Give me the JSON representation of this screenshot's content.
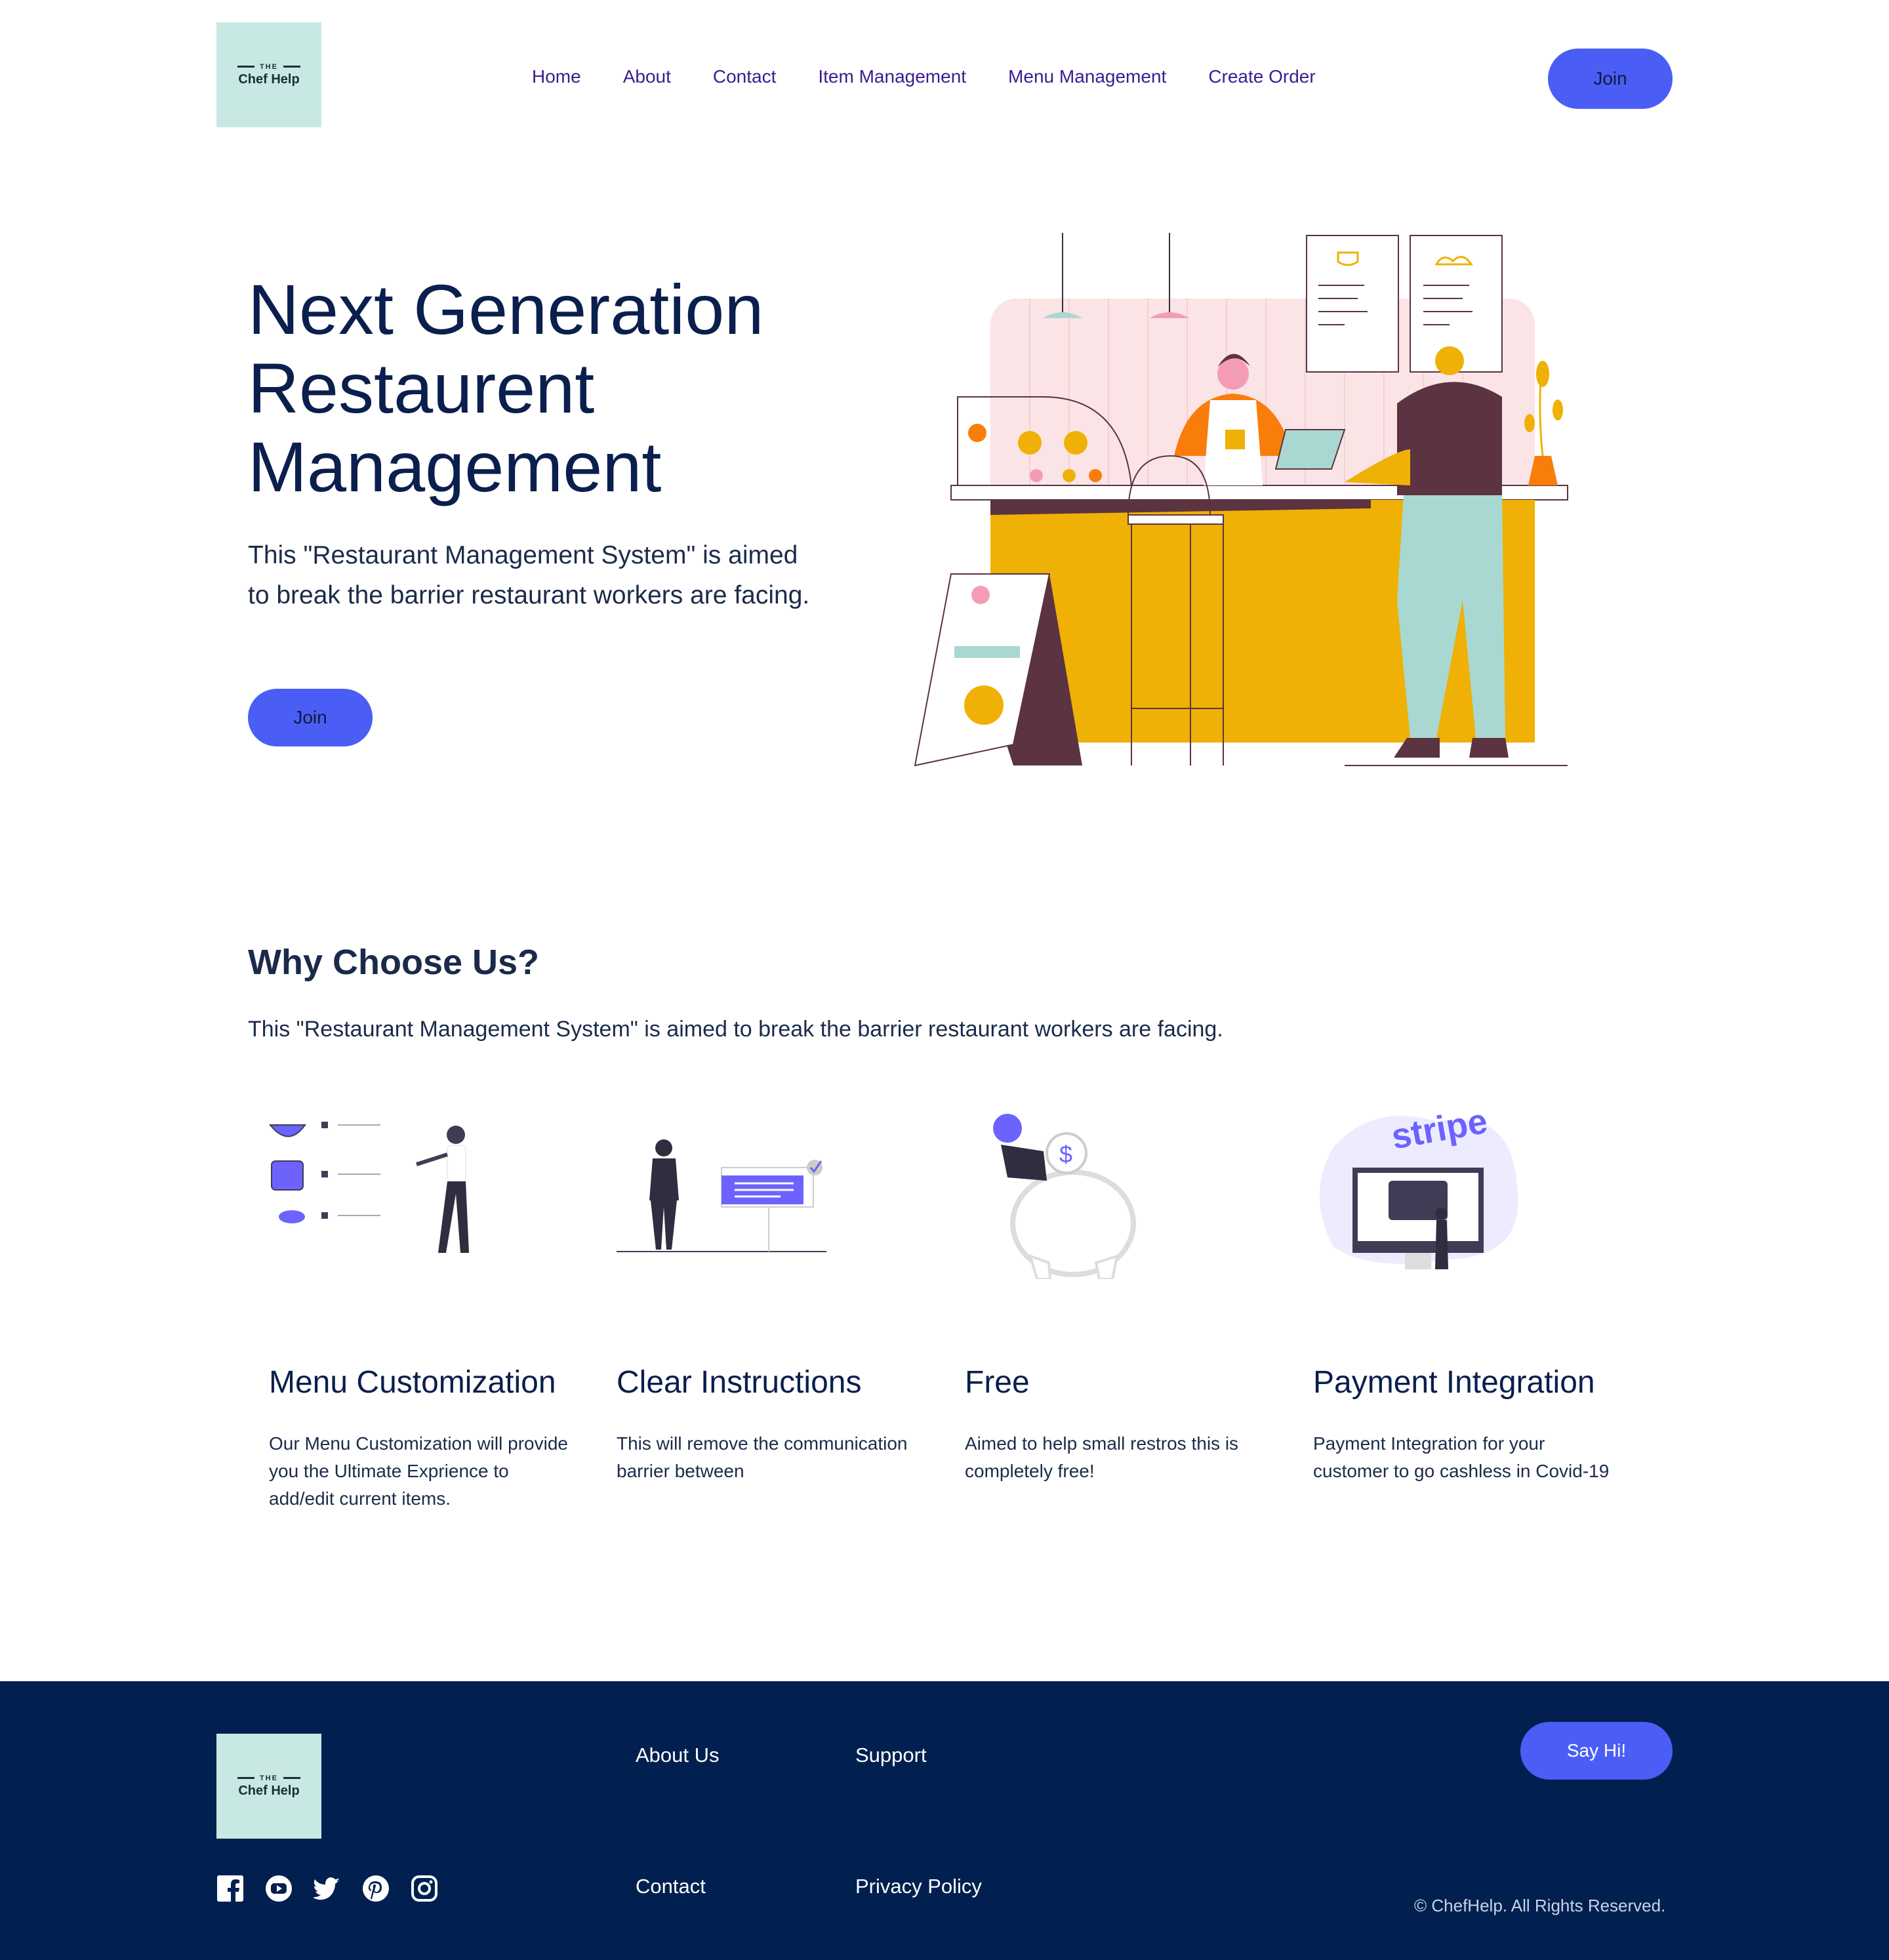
{
  "brand": {
    "logo_small": "THE",
    "logo_name": "Chef Help"
  },
  "nav": {
    "items": [
      "Home",
      "About",
      "Contact",
      "Item Management",
      "Menu Management",
      "Create Order"
    ],
    "join_label": "Join"
  },
  "hero": {
    "title_lines": [
      "Next Generation",
      "Restaurent",
      "Management"
    ],
    "subtitle": "This \"Restaurant Management System\" is aimed to break the barrier restaurant workers are facing.",
    "join_label": "Join",
    "illustration_icon": "cafe-counter-illustration"
  },
  "why": {
    "title": "Why Choose Us?",
    "subtitle": "This \"Restaurant Management System\" is aimed to break the barrier restaurant workers are facing.",
    "features": [
      {
        "title": "Menu Customization",
        "desc": "Our Menu Customization will provide you the Ultimate Exprience to add/edit current items.",
        "icon": "menu-customization-illustration"
      },
      {
        "title": "Clear Instructions",
        "desc": "This will remove the communication barrier between",
        "icon": "clear-instructions-illustration"
      },
      {
        "title": "Free",
        "desc": "Aimed to help small restros this is completely free!",
        "icon": "piggy-bank-illustration"
      },
      {
        "title": "Payment Integration",
        "desc": "Payment Integration for your customer to go cashless in Covid-19",
        "icon": "stripe-payment-illustration",
        "badge_text": "stripe"
      }
    ]
  },
  "footer": {
    "links": {
      "about": "About Us",
      "support": "Support",
      "contact": "Contact",
      "privacy": "Privacy Policy"
    },
    "say_hi_label": "Say Hi!",
    "social_icons": [
      "facebook-icon",
      "youtube-icon",
      "twitter-icon",
      "pinterest-icon",
      "instagram-icon"
    ],
    "copyright": "© ChefHelp. All Rights Reserved."
  },
  "colors": {
    "primary_button": "#4a5ef5",
    "nav_link": "#3b1d8f",
    "heading": "#0a1f4d",
    "footer_bg": "#02204f",
    "logo_bg": "#c8e8e4",
    "accent_yellow": "#efb106",
    "accent_orange": "#f97d0b"
  }
}
